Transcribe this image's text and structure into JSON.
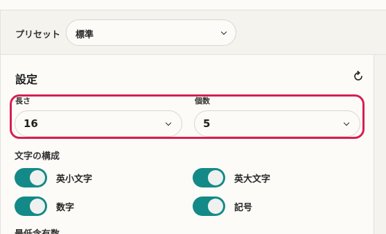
{
  "preset": {
    "label": "プリセット",
    "selected": "標準"
  },
  "settings": {
    "title": "設定",
    "reset_icon": "reset-icon",
    "length": {
      "label": "長さ",
      "value": "16"
    },
    "count": {
      "label": "個数",
      "value": "5"
    },
    "composition": {
      "title": "文字の構成",
      "options": [
        {
          "label": "英小文字",
          "enabled": true
        },
        {
          "label": "英大文字",
          "enabled": true
        },
        {
          "label": "数字",
          "enabled": true
        },
        {
          "label": "記号",
          "enabled": true
        }
      ]
    },
    "minimum_title": "最低含有数"
  },
  "colors": {
    "toggle_on": "#138a88",
    "highlight": "#d61f4e"
  }
}
